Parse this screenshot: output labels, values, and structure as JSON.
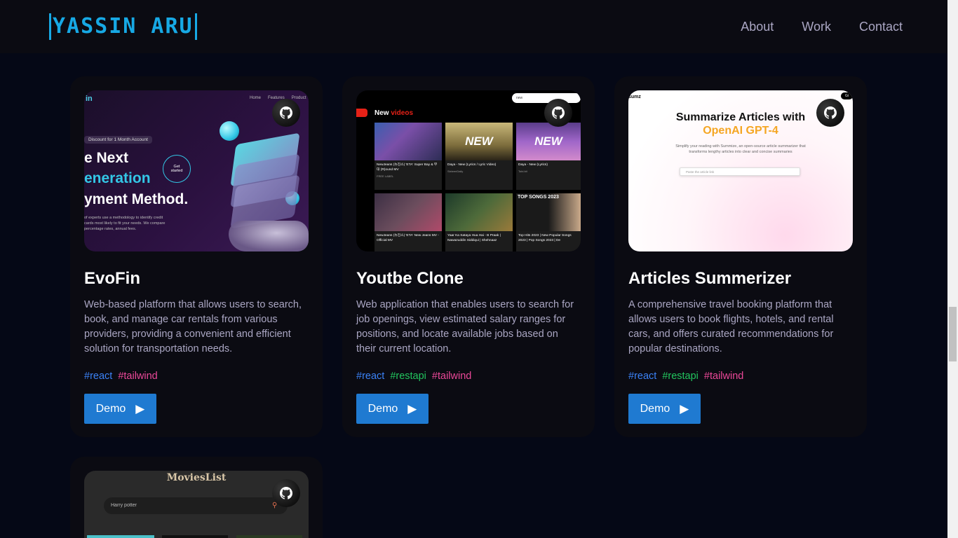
{
  "nav": {
    "logo": "YASSIN ARU",
    "links": [
      "About",
      "Work",
      "Contact"
    ]
  },
  "projects": [
    {
      "title": "EvoFin",
      "description": "Web-based platform that allows users to search, book, and manage car rentals from various providers, providing a convenient and efficient solution for transportation needs.",
      "tags": [
        "#react",
        "#tailwind"
      ],
      "demo_label": "Demo",
      "thumb": {
        "brand": "in",
        "nav": [
          "Home",
          "Features",
          "Product"
        ],
        "promo": "Discount for 1 Month Account",
        "headline": [
          "e Next",
          "eneration",
          "yment Method."
        ],
        "cta": "Get \nstarted",
        "body": "of experts use a methodology to identify credit cards most likely to fit your needs. We compare percentage rates, annual fees."
      }
    },
    {
      "title": "Youtbe Clone",
      "description": "Web application that enables users to search for job openings, view estimated salary ranges for positions, and locate available jobs based on their current location.",
      "tags": [
        "#react",
        "#restapi",
        "#tailwind"
      ],
      "demo_label": "Demo",
      "thumb": {
        "heading_white": "New",
        "heading_red": "videos",
        "search": "new",
        "videos": [
          {
            "caption": "NewJeans (뉴진스) 'ETA' Super Bay & 무대 (R)ound MV",
            "meta": "FREE LABEL",
            "overlay": ""
          },
          {
            "caption": "Daya - New (Lyrics / Lyric Video)",
            "meta": "SixteenDaily",
            "overlay": "NEW"
          },
          {
            "caption": "Daya - New (Lyrics)",
            "meta": "Tobi.bit",
            "overlay": "NEW"
          },
          {
            "caption": "NewJeans (뉴진스) 'ETA' New Jeans MV - Official MV",
            "meta": "HYBE LABELS",
            "overlay": ""
          },
          {
            "caption": "Yaar Ka Sataya Hua Hai - B Praak | Nawazuddin Siddiqui | Shehnaaz",
            "meta": "Desi Music Factory",
            "overlay": ""
          },
          {
            "caption": "Top Hits 2023 | New Popular Songs 2023 | Pop Songs 2023 | De",
            "meta": "Pop Mix Factory",
            "overlay": "TOP SONGS 2023"
          }
        ]
      }
    },
    {
      "title": "Articles Summerizer",
      "description": "A comprehensive travel booking platform that allows users to book flights, hotels, and rental cars, and offers curated recommendations for popular destinations.",
      "tags": [
        "#react",
        "#restapi",
        "#tailwind"
      ],
      "demo_label": "Demo",
      "thumb": {
        "brand": "sumz",
        "github_btn": "Gi",
        "headline": "Summarize Articles with",
        "headline_accent": "OpenAI GPT-4",
        "sub": "Simplify your reading with Summize, an open-source article summarizer that transforms lengthy articles into clear and concise summaries",
        "placeholder": "Paste the article link"
      }
    },
    {
      "title": "MoviesList",
      "thumb": {
        "brand": "MoviesList",
        "search": "Harry potter"
      }
    }
  ],
  "colors": {
    "background": "#050816",
    "card": "#0b0b12",
    "accent": "#17a9e5",
    "button": "#1f7ad1",
    "tag_blue": "#3b82f6",
    "tag_green": "#22c55e",
    "tag_pink": "#ec4899"
  }
}
